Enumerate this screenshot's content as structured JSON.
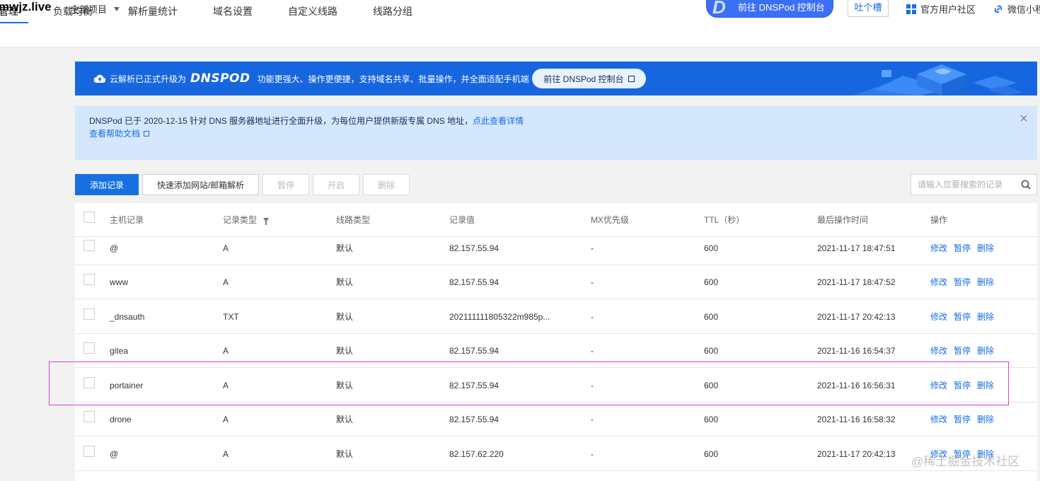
{
  "header": {
    "domain": "mwjz.live",
    "project_select": "全部项目",
    "console_button": "前往 DNSPod 控制台",
    "console_logo": "D",
    "feedback": "吐个槽",
    "community": "官方用户社区",
    "wechat": "微信小程"
  },
  "tabs": [
    {
      "label": "管理",
      "active": true
    },
    {
      "label": "负载均衡"
    },
    {
      "label": "解析量统计"
    },
    {
      "label": "域名设置"
    },
    {
      "label": "自定义线路"
    },
    {
      "label": "线路分组"
    }
  ],
  "banner": {
    "lead": "云解析已正式升级为",
    "logo": "DNSPOD",
    "text": "功能更强大、操作更便捷，支持域名共享、批量操作，并全面适配手机端",
    "button": "前往 DNSPod 控制台"
  },
  "notice": {
    "text": "DNSPod 已于 2020-12-15 针对 DNS 服务器地址进行全面升级，为每位用户提供新版专属 DNS 地址，",
    "link": "点此查看详情",
    "help": "查看帮助文档"
  },
  "toolbar": {
    "add": "添加记录",
    "quick_add": "快速添加网站/邮箱解析",
    "pause": "暂停",
    "enable": "开启",
    "delete": "删除",
    "search_placeholder": "请输入您要搜索的记录"
  },
  "table": {
    "columns": [
      "主机记录",
      "记录类型",
      "线路类型",
      "记录值",
      "MX优先级",
      "TTL（秒）",
      "最后操作时间",
      "操作"
    ],
    "actions": [
      "修改",
      "暂停",
      "删除"
    ],
    "rows": [
      {
        "host": "@",
        "type": "A",
        "line": "默认",
        "value": "82.157.55.94",
        "mx": "-",
        "ttl": "600",
        "time": "2021-11-17 18:47:51"
      },
      {
        "host": "www",
        "type": "A",
        "line": "默认",
        "value": "82.157.55.94",
        "mx": "-",
        "ttl": "600",
        "time": "2021-11-17 18:47:52"
      },
      {
        "host": "_dnsauth",
        "type": "TXT",
        "line": "默认",
        "value": "202111111805322m985p...",
        "mx": "-",
        "ttl": "600",
        "time": "2021-11-17 20:42:13"
      },
      {
        "host": "gitea",
        "type": "A",
        "line": "默认",
        "value": "82.157.55.94",
        "mx": "-",
        "ttl": "600",
        "time": "2021-11-16 16:54:37"
      },
      {
        "host": "portainer",
        "type": "A",
        "line": "默认",
        "value": "82.157.55.94",
        "mx": "-",
        "ttl": "600",
        "time": "2021-11-16 16:56:31"
      },
      {
        "host": "drone",
        "type": "A",
        "line": "默认",
        "value": "82.157.55.94",
        "mx": "-",
        "ttl": "600",
        "time": "2021-11-16 16:58:32"
      },
      {
        "host": "@",
        "type": "A",
        "line": "默认",
        "value": "82.157.62.220",
        "mx": "-",
        "ttl": "600",
        "time": "2021-11-17 20:42:13"
      }
    ]
  },
  "watermark": "@稀土掘金技术社区",
  "colors": {
    "primary": "#1770e0",
    "banner": "#1666e0",
    "notice_bg": "#d5e7fd",
    "highlight": "#d63ed6"
  }
}
